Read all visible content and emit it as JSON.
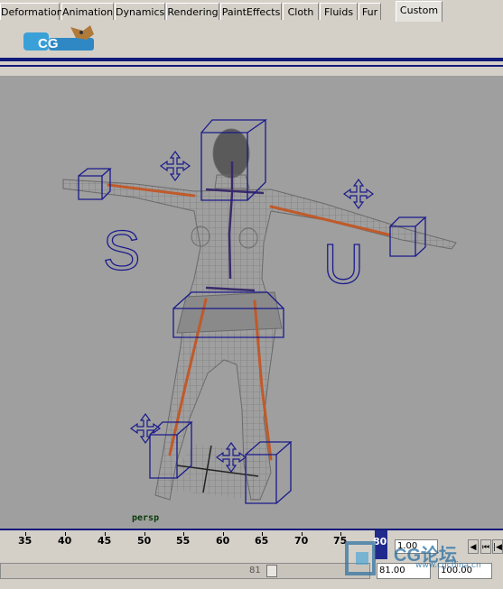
{
  "tabs": [
    "Deformation",
    "Animation",
    "Dynamics",
    "Rendering",
    "PaintEffects",
    "Cloth",
    "Fluids",
    "Fur",
    "Custom"
  ],
  "active_tab": "Custom",
  "viewport": {
    "camera_label": "persp",
    "letters": [
      "S",
      "U"
    ]
  },
  "timeline": {
    "ticks": [
      "35",
      "40",
      "45",
      "50",
      "55",
      "60",
      "65",
      "70",
      "75",
      "80"
    ],
    "current_frame": "80",
    "current_time_field": "1.00",
    "start_field": "81.00",
    "end_field": "100.00",
    "range_frame": "81"
  },
  "watermark": {
    "logo": "CG论坛",
    "url": "www.cgchina.cn"
  },
  "colors": {
    "accent": "#101a7a",
    "viewport_bg": "#9f9f9f",
    "bone": "#c05a2a",
    "control": "#1a1a8c"
  }
}
